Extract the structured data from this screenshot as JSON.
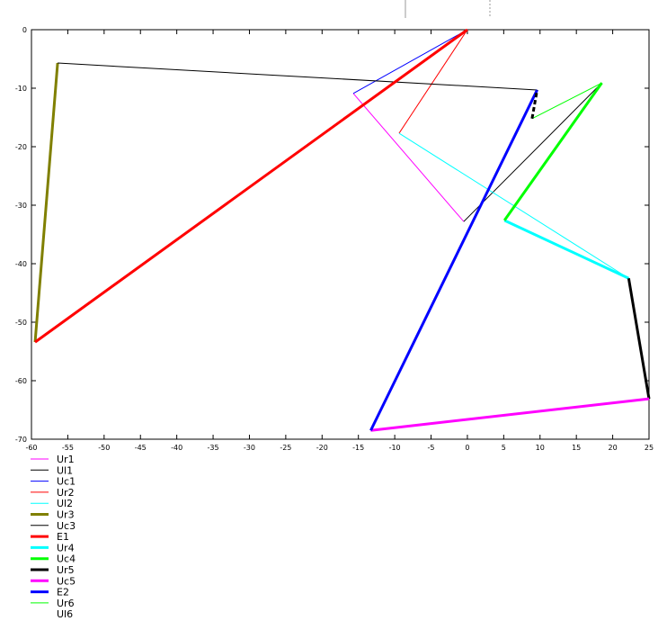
{
  "chart_data": {
    "type": "line",
    "title": "",
    "xlabel": "",
    "ylabel": "",
    "xlim": [
      -60,
      25
    ],
    "ylim": [
      -70,
      0
    ],
    "grid": false,
    "legend_placement": "bottom-left",
    "xticks": [
      -60,
      -55,
      -50,
      -45,
      -40,
      -35,
      -30,
      -25,
      -20,
      -15,
      -10,
      -5,
      0,
      5,
      10,
      15,
      20,
      25
    ],
    "yticks": [
      0,
      -10,
      -20,
      -30,
      -40,
      -50,
      -60,
      -70
    ],
    "series": [
      {
        "name": "Ur1",
        "color": "#ff00ff",
        "width": 1,
        "x": [
          -15.7,
          -0.5
        ],
        "y": [
          -10.9,
          -32.8
        ]
      },
      {
        "name": "Ul1",
        "color": "#000000",
        "width": 1,
        "x": [
          -0.5,
          18.5
        ],
        "y": [
          -32.8,
          -9.1
        ]
      },
      {
        "name": "Uc1",
        "color": "#0000ff",
        "width": 1,
        "x": [
          0,
          -15.7
        ],
        "y": [
          0,
          -10.9
        ]
      },
      {
        "name": "Ur2",
        "color": "#ff0000",
        "width": 1,
        "x": [
          0,
          -9.4
        ],
        "y": [
          0,
          -17.7
        ]
      },
      {
        "name": "Ul2",
        "color": "#00ffff",
        "width": 1,
        "x": [
          -9.4,
          22.2
        ],
        "y": [
          -17.7,
          -42.5
        ]
      },
      {
        "name": "Ur3",
        "color": "#808000",
        "width": 3,
        "x": [
          -59.5,
          -56.4
        ],
        "y": [
          -53.4,
          -5.7
        ]
      },
      {
        "name": "Uc3",
        "color": "#000000",
        "width": 1,
        "x": [
          -56.4,
          9.6
        ],
        "y": [
          -5.7,
          -10.3
        ]
      },
      {
        "name": "E1",
        "color": "#ff0000",
        "width": 3,
        "x": [
          -59.5,
          0
        ],
        "y": [
          -53.4,
          0
        ]
      },
      {
        "name": "Ur4",
        "color": "#00ffff",
        "width": 3,
        "x": [
          22.2,
          5.1
        ],
        "y": [
          -42.5,
          -32.6
        ]
      },
      {
        "name": "Uc4",
        "color": "#00ff00",
        "width": 3,
        "x": [
          5.1,
          18.5
        ],
        "y": [
          -32.6,
          -9.1
        ]
      },
      {
        "name": "Ur5",
        "color": "#000000",
        "width": 3,
        "x": [
          22.2,
          25
        ],
        "y": [
          -42.5,
          -63.1
        ]
      },
      {
        "name": "Uc5",
        "color": "#ff00ff",
        "width": 3,
        "x": [
          25,
          -13.3
        ],
        "y": [
          -63.1,
          -68.5
        ]
      },
      {
        "name": "E2",
        "color": "#0000ff",
        "width": 3,
        "x": [
          -13.3,
          9.6
        ],
        "y": [
          -68.5,
          -10.3
        ]
      },
      {
        "name": "Ur6",
        "color": "#00ff00",
        "width": 1,
        "x": [
          18.5,
          8.9
        ],
        "y": [
          -9.1,
          -15.2
        ]
      },
      {
        "name": "Ul6",
        "color": "#000000",
        "width": 3,
        "dashed": true,
        "legend_color": "#ffffff",
        "x": [
          8.9,
          9.6
        ],
        "y": [
          -15.2,
          -10.3
        ]
      }
    ]
  }
}
